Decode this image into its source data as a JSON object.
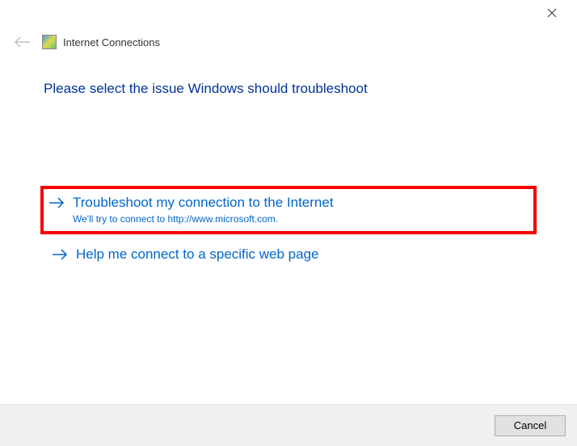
{
  "titlebar": {
    "close_label": "Close"
  },
  "header": {
    "title": "Internet Connections"
  },
  "main": {
    "heading": "Please select the issue Windows should troubleshoot",
    "options": [
      {
        "title": "Troubleshoot my connection to the Internet",
        "subtitle": "We'll try to connect to http://www.microsoft.com.",
        "highlighted": true
      },
      {
        "title": "Help me connect to a specific web page",
        "subtitle": "",
        "highlighted": false
      }
    ]
  },
  "footer": {
    "cancel_label": "Cancel"
  }
}
